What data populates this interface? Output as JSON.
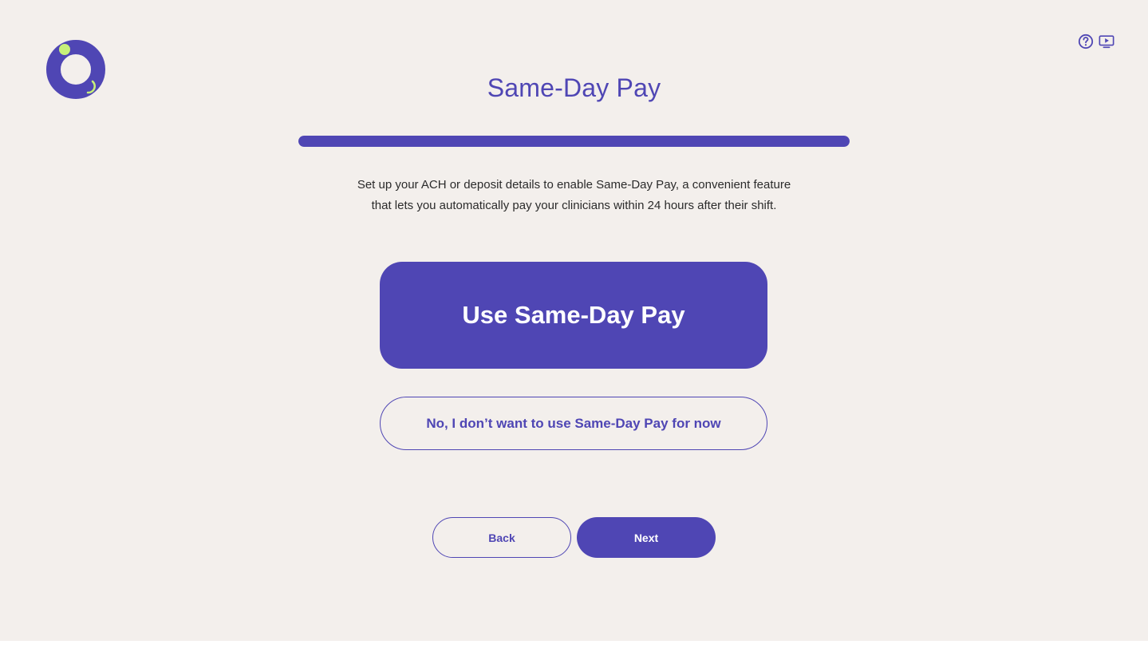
{
  "header": {
    "logo_icon": "ring-logo-icon",
    "help_icon": "question-circle-icon",
    "video_icon": "play-screen-icon"
  },
  "page": {
    "title": "Same-Day Pay",
    "progress": 1.0,
    "description_line1": "Set up your ACH or deposit details to enable Same-Day Pay, a convenient feature",
    "description_line2": "that lets you automatically pay your clinicians within 24 hours after their shift."
  },
  "options": {
    "use_label": "Use Same-Day Pay",
    "decline_label": "No, I don’t want to use Same-Day Pay for now"
  },
  "footer": {
    "back_label": "Back",
    "next_label": "Next"
  },
  "colors": {
    "background": "#f3efec",
    "accent": "#4f46b4",
    "logo_dot": "#c7f07a"
  }
}
